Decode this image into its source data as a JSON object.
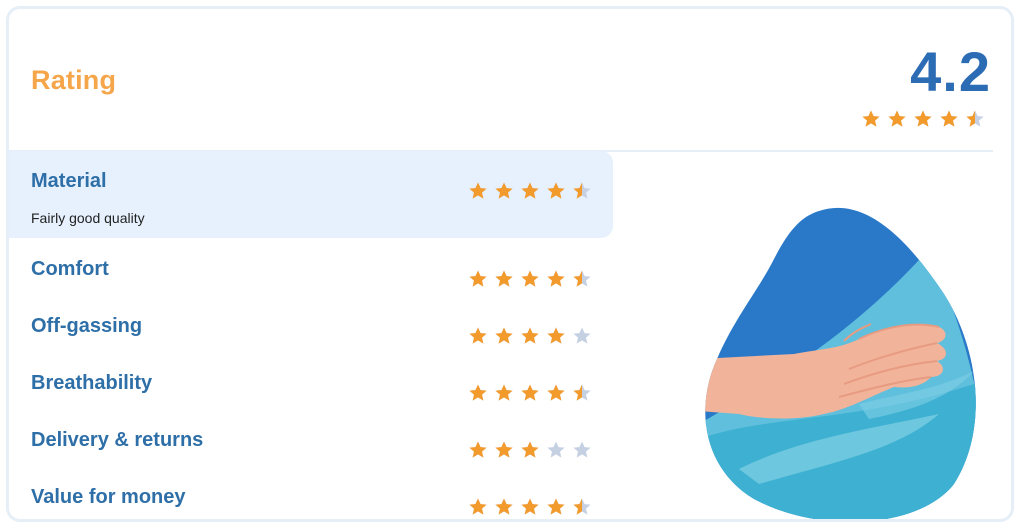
{
  "header": {
    "title": "Rating",
    "score": "4.2",
    "overall_stars": 4.5
  },
  "categories": [
    {
      "label": "Material",
      "sublabel": "Fairly good quality",
      "stars": 4.5,
      "active": true
    },
    {
      "label": "Comfort",
      "stars": 4.5
    },
    {
      "label": "Off-gassing",
      "stars": 4
    },
    {
      "label": "Breathability",
      "stars": 4.5
    },
    {
      "label": "Delivery & returns",
      "stars": 3
    },
    {
      "label": "Value for money",
      "stars": 4.5
    }
  ],
  "illustration": {
    "icon": "hand-on-mattress-illustration"
  },
  "colors": {
    "accent": "#f5a54a",
    "primary": "#2b6cb5",
    "label": "#2e6fa8",
    "star_filled": "#f39a2c",
    "star_empty": "#c5d1e2",
    "active_bg": "#e7f1fd"
  }
}
